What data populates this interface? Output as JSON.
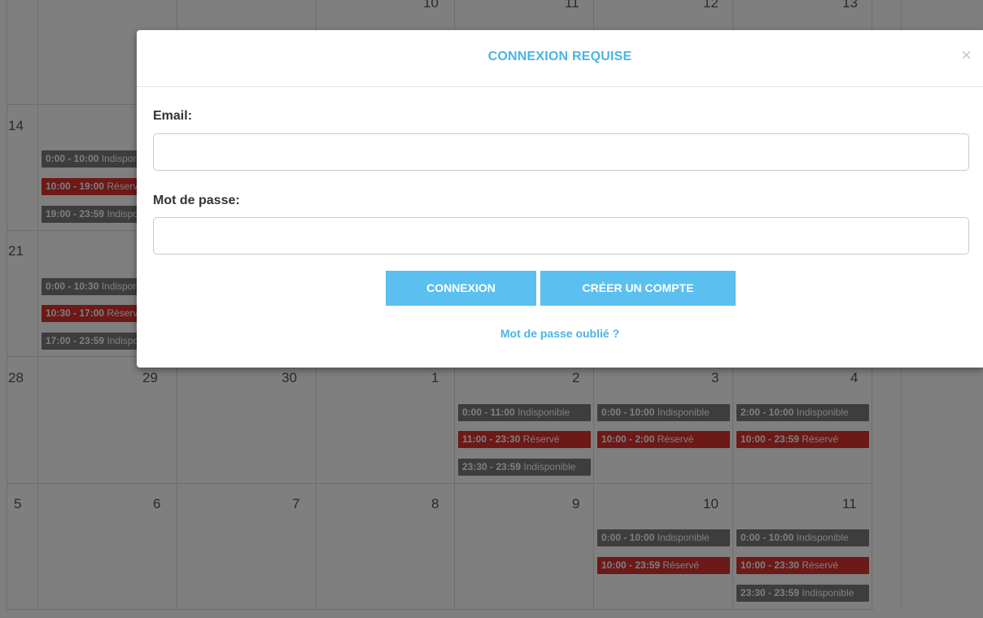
{
  "calendar": {
    "weeks": [
      {
        "days": [
          "",
          "",
          "",
          "10",
          "11",
          "12",
          "13"
        ]
      },
      {
        "days": [
          "14",
          "",
          "",
          "",
          "",
          "",
          ""
        ]
      },
      {
        "days": [
          "21",
          "",
          "",
          "",
          "",
          "",
          ""
        ]
      },
      {
        "days": [
          "28",
          "29",
          "30",
          "1",
          "2",
          "3",
          "4"
        ]
      },
      {
        "days": [
          "5",
          "6",
          "7",
          "8",
          "9",
          "10",
          "11"
        ]
      }
    ],
    "events": [
      {
        "time": "0:00 - 10:00",
        "label": "Indisponible",
        "type": "grey"
      },
      {
        "time": "10:00 - 19:00",
        "label": "Réservé",
        "type": "red"
      },
      {
        "time": "19:00 - 23:59",
        "label": "Indisponible",
        "type": "grey"
      },
      {
        "time": "0:00 - 10:30",
        "label": "Indisponible",
        "type": "grey"
      },
      {
        "time": "10:30 - 17:00",
        "label": "Réservé",
        "type": "red"
      },
      {
        "time": "17:00 - 23:59",
        "label": "Indisponible",
        "type": "grey"
      },
      {
        "time": "0:00 - 11:00",
        "label": "Indisponible",
        "type": "grey"
      },
      {
        "time": "11:00 - 23:30",
        "label": "Réservé",
        "type": "red"
      },
      {
        "time": "23:30 - 23:59",
        "label": "Indisponible",
        "type": "grey"
      },
      {
        "time": "0:00 - 10:00",
        "label": "Indisponible",
        "type": "grey"
      },
      {
        "time": "10:00 - 2:00",
        "label": "Réservé",
        "type": "red"
      },
      {
        "time": "2:00 - 10:00",
        "label": "Indisponible",
        "type": "grey"
      },
      {
        "time": "10:00 - 23:59",
        "label": "Réservé",
        "type": "red"
      },
      {
        "time": "0:00 - 10:00",
        "label": "Indisponible",
        "type": "grey"
      },
      {
        "time": "10:00 - 23:59",
        "label": "Réservé",
        "type": "red"
      },
      {
        "time": "0:00 - 10:00",
        "label": "Indisponible",
        "type": "grey"
      },
      {
        "time": "10:00 - 23:30",
        "label": "Réservé",
        "type": "red"
      },
      {
        "time": "23:30 - 23:59",
        "label": "Indisponible",
        "type": "grey"
      }
    ]
  },
  "modal": {
    "title": "CONNEXION REQUISE",
    "close_symbol": "×",
    "email_label": "Email:",
    "email_value": "",
    "password_label": "Mot de passe:",
    "password_value": "",
    "login_button": "CONNEXION",
    "create_account_button": "CRÉER UN COMPTE",
    "forgot_password_link": "Mot de passe oublié ?"
  },
  "colors": {
    "accent": "#4ab4e6",
    "button": "#5bc0f0",
    "event_reserved": "#d9322e",
    "event_unavailable": "#7a7a7a"
  },
  "icons": {
    "close": "close-icon"
  }
}
